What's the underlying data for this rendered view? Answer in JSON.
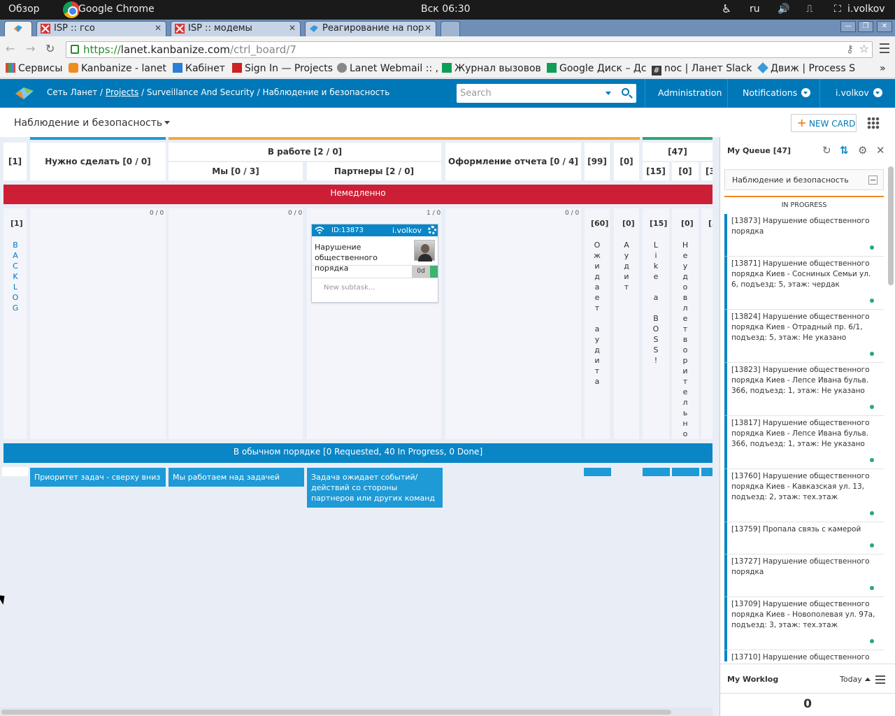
{
  "os": {
    "overview": "Обзор",
    "app": "Google Chrome",
    "clock": "Вск 06:30",
    "lang": "ru",
    "user": "i.volkov"
  },
  "tabs": [
    {
      "label": "ISP :: гсо"
    },
    {
      "label": "ISP :: модемы"
    },
    {
      "label": "Реагирование на пор"
    }
  ],
  "address": {
    "scheme": "https://",
    "host": "lanet.kanbanize.com",
    "path": "/ctrl_board/7"
  },
  "bookmarks": [
    "Сервисы",
    "Kanbanize - lanet",
    "Кабінет",
    "Sign In — Projects",
    "Lanet Webmail :: ,",
    "Журнал вызовов",
    "Google Диск – Дс",
    "noc | Ланет Slack",
    "Движ | Process S"
  ],
  "bookmarks_more": "»",
  "header": {
    "crumb1": "Сеть Ланет /",
    "crumb2": "Projects",
    "crumb3": "/ Surveillance And Security / Наблюдение и безопасность",
    "search_placeholder": "Search",
    "admin": "Administration",
    "notifications": "Notifications",
    "user": "i.volkov"
  },
  "board": {
    "title": "Наблюдение и безопасность",
    "new_card": "NEW CARD",
    "columns": {
      "backlog_count": "[1]",
      "todo": "Нужно сделать [0 / 0]",
      "inwork": "В работе [2 / 0]",
      "we": "Мы [0 / 3]",
      "partners": "Партнеры [2 / 0]",
      "report": "Оформление отчета [0 / 4]",
      "c99": "[99]",
      "c0a": "[0]",
      "c47": "[47]",
      "c15": "[15]",
      "c0b": "[0]",
      "c3": "[3"
    },
    "lane_urgent": "Немедленно",
    "lane_normal": "В обычном порядке [0 Requested, 40 In Progress, 0 Done]",
    "counts": {
      "todo": "0 / 0",
      "we": "0 / 0",
      "partners": "1 / 0",
      "report": "0 / 0"
    },
    "vert": {
      "backlog_num": "[1]",
      "backlog": "BACKLOG",
      "await_num": "[60]",
      "await": "Ожидает аудита",
      "audit_num": "[0]",
      "audit": "Аудит",
      "boss_num": "[15]",
      "boss": "Like a BOSS!",
      "bad_num": "[0]",
      "bad": "Неудовлетворительно",
      "last_num": "[3"
    },
    "notes": {
      "priority": "Приоритет задач - сверху вниз",
      "working": "Мы работаем над задачей",
      "waiting": "Задача ожидает событий/ действий со стороны партнеров или других команд"
    },
    "card": {
      "id": "ID:13873",
      "owner": "i.volkov",
      "title": "Нарушение общественного порядка",
      "age": "0d",
      "subtask": "New subtask..."
    }
  },
  "queue": {
    "title": "My Queue [47]",
    "filter": "Наблюдение и безопасность",
    "section": "IN PROGRESS",
    "items": [
      "[13873] Нарушение общественного порядка",
      "[13871] Нарушение общественного порядка Киев - Сосниных Семьи ул. 6, подъезд: 5, этаж: чердак",
      "[13824] Нарушение общественного порядка Киев - Отрадный пр. 6/1, подъезд: 5, этаж: Не указано",
      "[13823] Нарушение общественного порядка Киев - Лепсе Ивана бульв. 366, подъезд: 1, этаж: Не указано",
      "[13817] Нарушение общественного порядка Киев - Лепсе Ивана бульв. 366, подъезд: 1, этаж: Не указано",
      "[13760] Нарушение общественного порядка Киев - Кавказская ул. 13, подъезд: 2, этаж: тех.этаж",
      "[13759] Пропала связь с камерой",
      "[13727] Нарушение общественного порядка",
      "[13709] Нарушение общественного порядка Киев - Новополевая ул. 97а, подъезд: 3, этаж: тех.этаж",
      "[13710] Нарушение общественного"
    ],
    "worklog": "My Worklog",
    "today": "Today",
    "worklog_count": "0"
  },
  "colors": {
    "brand": "#0078b8",
    "urgent": "#cc1f36",
    "note": "#1e9ad6",
    "accent": "#f08c1e",
    "done": "#2aa876"
  }
}
